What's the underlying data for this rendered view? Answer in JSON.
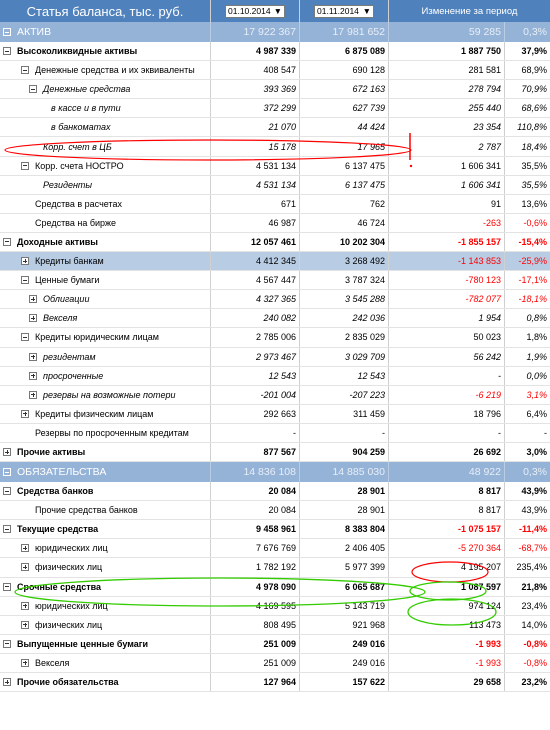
{
  "header": {
    "title": "Статья баланса, тыс. руб.",
    "date1": "01.10.2014",
    "date2": "01.11.2014",
    "change_label": "Изменение за период"
  },
  "colors": {
    "header_bg": "#4f81bd",
    "section_bg": "#95b3d7",
    "selected_bg": "#b8cce4",
    "negative": "#ff0000",
    "annotation_red": "#ff0000",
    "annotation_green": "#33cc00"
  },
  "rows": [
    {
      "type": "sec",
      "tog": "minus",
      "label": "АКТИВ",
      "v1": "17 922 367",
      "v2": "17 981 652",
      "ch": "59 285",
      "pc": "0,3%",
      "icon": "pie"
    },
    {
      "tog": "minus",
      "label": "Высоколиквидные активы",
      "indent": 0,
      "bold": true,
      "v1": "4 987 339",
      "v2": "6 875 089",
      "ch": "1 887 750",
      "pc": "37,9%",
      "icon": "line"
    },
    {
      "tog": "minus",
      "label": "Денежные средства и их эквиваленты",
      "indent": 1,
      "v1": "408 547",
      "v2": "690 128",
      "ch": "281 581",
      "pc": "68,9%",
      "icon": "line"
    },
    {
      "tog": "minus",
      "label": "Денежные средства",
      "indent": 2,
      "italic": true,
      "v1": "393 369",
      "v2": "672 163",
      "ch": "278 794",
      "pc": "70,9%",
      "icon": "line"
    },
    {
      "label": "в кассе и в пути",
      "indent": 3,
      "italic": true,
      "v1": "372 299",
      "v2": "627 739",
      "ch": "255 440",
      "pc": "68,6%",
      "icon": "line"
    },
    {
      "label": "в банкоматах",
      "indent": 3,
      "italic": true,
      "v1": "21 070",
      "v2": "44 424",
      "ch": "23 354",
      "pc": "110,8%",
      "icon": "line"
    },
    {
      "label": "Корр. счет в ЦБ",
      "indent": 2,
      "italic": true,
      "v1": "15 178",
      "v2": "17 965",
      "ch": "2 787",
      "pc": "18,4%",
      "icon": "line"
    },
    {
      "tog": "minus",
      "label": "Корр. счета НОСТРО",
      "indent": 1,
      "v1": "4 531 134",
      "v2": "6 137 475",
      "ch": "1 606 341",
      "pc": "35,5%",
      "icon": "bar"
    },
    {
      "label": "Резиденты",
      "indent": 2,
      "italic": true,
      "v1": "4 531 134",
      "v2": "6 137 475",
      "ch": "1 606 341",
      "pc": "35,5%",
      "icon": "line"
    },
    {
      "label": "Средства в расчетах",
      "indent": 1,
      "v1": "671",
      "v2": "762",
      "ch": "91",
      "pc": "13,6%",
      "icon": "line"
    },
    {
      "label": "Средства на бирже",
      "indent": 1,
      "v1": "46 987",
      "v2": "46 724",
      "ch": "-263",
      "pc": "-0,6%",
      "neg": true,
      "icon": "line"
    },
    {
      "tog": "minus",
      "label": "Доходные активы",
      "indent": 0,
      "bold": true,
      "v1": "12 057 461",
      "v2": "10 202 304",
      "ch": "-1 855 157",
      "pc": "-15,4%",
      "neg": true,
      "icon": "line"
    },
    {
      "tog": "plus",
      "label": "Кредиты банкам",
      "indent": 1,
      "sel": true,
      "v1": "4 412 345",
      "v2": "3 268 492",
      "ch": "-1 143 853",
      "pc": "-25,9%",
      "neg": true,
      "icon": "bar"
    },
    {
      "tog": "minus",
      "label": "Ценные бумаги",
      "indent": 1,
      "v1": "4 567 447",
      "v2": "3 787 324",
      "ch": "-780 123",
      "pc": "-17,1%",
      "neg": true,
      "icon": "line"
    },
    {
      "tog": "plus",
      "label": "Облигации",
      "indent": 2,
      "italic": true,
      "v1": "4 327 365",
      "v2": "3 545 288",
      "ch": "-782 077",
      "pc": "-18,1%",
      "neg": true,
      "icon": "line"
    },
    {
      "tog": "plus",
      "label": "Векселя",
      "indent": 2,
      "italic": true,
      "v1": "240 082",
      "v2": "242 036",
      "ch": "1 954",
      "pc": "0,8%",
      "icon": "line"
    },
    {
      "tog": "minus",
      "label": "Кредиты юридическим лицам",
      "indent": 1,
      "v1": "2 785 006",
      "v2": "2 835 029",
      "ch": "50 023",
      "pc": "1,8%",
      "icon": "barline"
    },
    {
      "tog": "plus",
      "label": "резидентам",
      "indent": 2,
      "italic": true,
      "v1": "2 973 467",
      "v2": "3 029 709",
      "ch": "56 242",
      "pc": "1,9%",
      "icon": "line"
    },
    {
      "tog": "plus",
      "label": "просроченные",
      "indent": 2,
      "italic": true,
      "v1": "12 543",
      "v2": "12 543",
      "ch": "-",
      "pc": "0,0%",
      "icon": "line"
    },
    {
      "tog": "plus",
      "label": "резервы на возможные потери",
      "indent": 2,
      "italic": true,
      "v1": "-201 004",
      "v2": "-207 223",
      "ch": "-6 219",
      "pc": "3,1%",
      "neg": true,
      "icon": "line"
    },
    {
      "tog": "plus",
      "label": "Кредиты физическим лицам",
      "indent": 1,
      "v1": "292 663",
      "v2": "311 459",
      "ch": "18 796",
      "pc": "6,4%",
      "icon": "line"
    },
    {
      "label": "Резервы по просроченным кредитам",
      "indent": 1,
      "v1": "-",
      "v2": "-",
      "ch": "-",
      "pc": "-",
      "icon": "line"
    },
    {
      "tog": "plus",
      "label": "Прочие активы",
      "indent": 0,
      "bold": true,
      "v1": "877 567",
      "v2": "904 259",
      "ch": "26 692",
      "pc": "3,0%",
      "icon": "line"
    },
    {
      "type": "sec",
      "tog": "minus",
      "label": "ОБЯЗАТЕЛЬСТВА",
      "v1": "14 836 108",
      "v2": "14 885 030",
      "ch": "48 922",
      "pc": "0,3%",
      "icon": "pie"
    },
    {
      "tog": "minus",
      "label": "Средства банков",
      "indent": 0,
      "bold": true,
      "v1": "20 084",
      "v2": "28 901",
      "ch": "8 817",
      "pc": "43,9%",
      "icon": "line"
    },
    {
      "label": "Прочие средства банков",
      "indent": 1,
      "v1": "20 084",
      "v2": "28 901",
      "ch": "8 817",
      "pc": "43,9%",
      "icon": "line"
    },
    {
      "tog": "minus",
      "label": "Текущие средства",
      "indent": 0,
      "bold": true,
      "v1": "9 458 961",
      "v2": "8 383 804",
      "ch": "-1 075 157",
      "pc": "-11,4%",
      "neg": true,
      "icon": "line"
    },
    {
      "tog": "plus",
      "label": "юридических лиц",
      "indent": 1,
      "v1": "7 676 769",
      "v2": "2 406 405",
      "ch": "-5 270 364",
      "pc": "-68,7%",
      "neg": true,
      "icon": "line"
    },
    {
      "tog": "plus",
      "label": "физических лиц",
      "indent": 1,
      "v1": "1 782 192",
      "v2": "5 977 399",
      "ch": "4 195 207",
      "pc": "235,4%",
      "icon": "line"
    },
    {
      "tog": "minus",
      "label": "Срочные средства",
      "indent": 0,
      "bold": true,
      "v1": "4 978 090",
      "v2": "6 065 687",
      "ch": "1 087 597",
      "pc": "21,8%",
      "icon": "line"
    },
    {
      "tog": "plus",
      "label": "юридических лиц",
      "indent": 1,
      "v1": "4 169 595",
      "v2": "5 143 719",
      "ch": "974 124",
      "pc": "23,4%",
      "icon": "line"
    },
    {
      "tog": "plus",
      "label": "физических лиц",
      "indent": 1,
      "v1": "808 495",
      "v2": "921 968",
      "ch": "113 473",
      "pc": "14,0%",
      "icon": "line"
    },
    {
      "tog": "minus",
      "label": "Выпущенные ценные бумаги",
      "indent": 0,
      "bold": true,
      "v1": "251 009",
      "v2": "249 016",
      "ch": "-1 993",
      "pc": "-0,8%",
      "neg": true,
      "icon": "line"
    },
    {
      "tog": "plus",
      "label": "Векселя",
      "indent": 1,
      "v1": "251 009",
      "v2": "249 016",
      "ch": "-1 993",
      "pc": "-0,8%",
      "neg": true,
      "icon": "line"
    },
    {
      "tog": "plus",
      "label": "Прочие обязательства",
      "indent": 0,
      "bold": true,
      "v1": "127 964",
      "v2": "157 622",
      "ch": "29 658",
      "pc": "23,2%",
      "icon": "line"
    }
  ]
}
